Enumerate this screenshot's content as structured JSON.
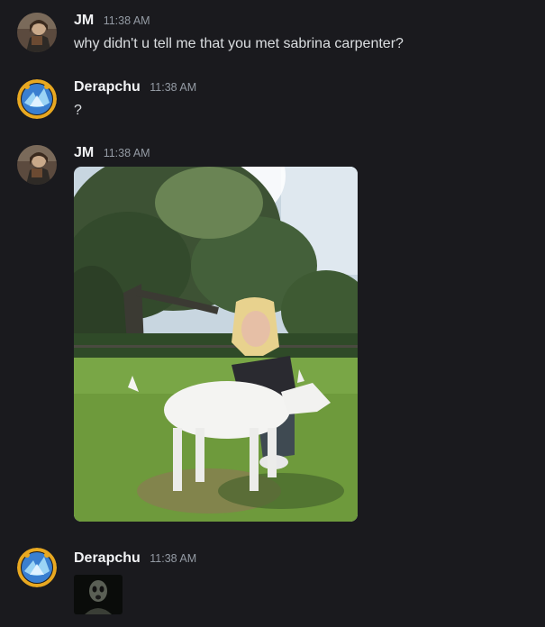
{
  "messages": [
    {
      "author": "JM",
      "time": "11:38 AM",
      "text": "why didn't u tell me that you met sabrina carpenter?"
    },
    {
      "author": "Derapchu",
      "time": "11:38 AM",
      "text": "?"
    },
    {
      "author": "JM",
      "time": "11:38 AM"
    },
    {
      "author": "Derapchu",
      "time": "11:38 AM"
    }
  ],
  "colors": {
    "background": "#1a1a1e",
    "username": "#f2f3f5",
    "timestamp": "#949ba4",
    "message_text": "#dbdee1"
  }
}
